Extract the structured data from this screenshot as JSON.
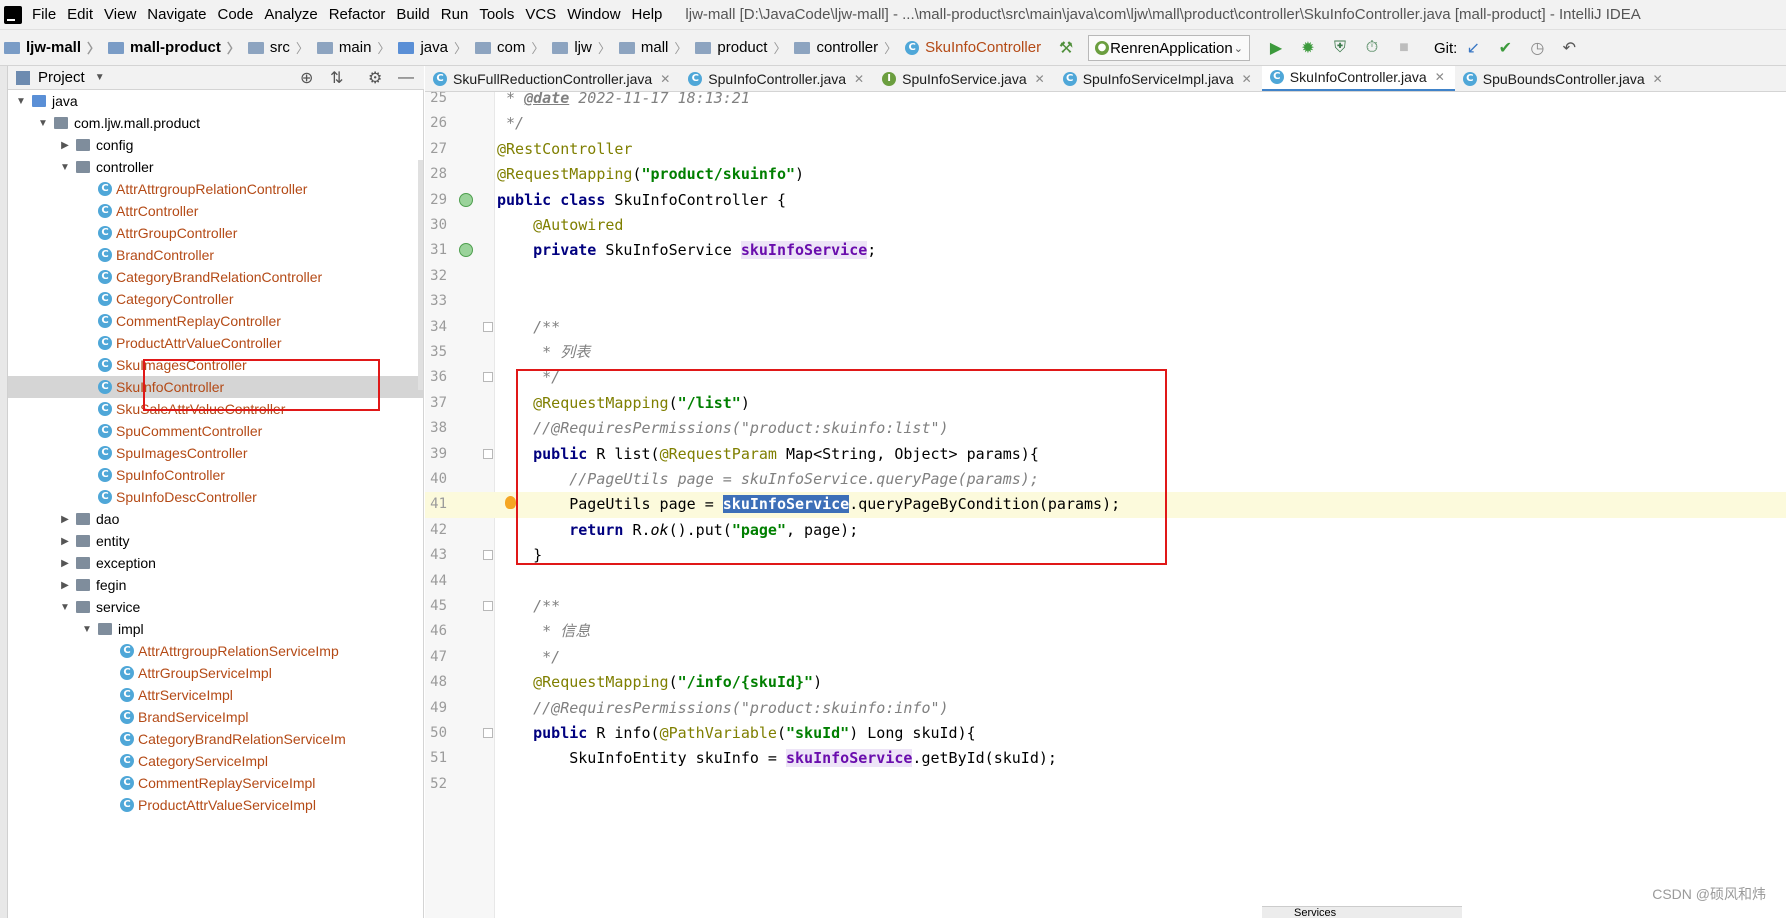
{
  "menubar": {
    "items": [
      "File",
      "Edit",
      "View",
      "Navigate",
      "Code",
      "Analyze",
      "Refactor",
      "Build",
      "Run",
      "Tools",
      "VCS",
      "Window",
      "Help"
    ],
    "title": "ljw-mall [D:\\JavaCode\\ljw-mall] - ...\\mall-product\\src\\main\\java\\com\\ljw\\mall\\product\\controller\\SkuInfoController.java [mall-product] - IntelliJ IDEA"
  },
  "breadcrumb": [
    "ljw-mall",
    "mall-product",
    "src",
    "main",
    "java",
    "com",
    "ljw",
    "mall",
    "product",
    "controller",
    "SkuInfoController"
  ],
  "run_config": "RenrenApplication",
  "git_label": "Git:",
  "project_panel": {
    "label": "Project"
  },
  "tree": [
    {
      "label": "java",
      "indent": 1,
      "arrow": "down",
      "type": "src"
    },
    {
      "label": "com.ljw.mall.product",
      "indent": 2,
      "arrow": "down",
      "type": "pkg"
    },
    {
      "label": "config",
      "indent": 3,
      "arrow": "right",
      "type": "pkg"
    },
    {
      "label": "controller",
      "indent": 3,
      "arrow": "down",
      "type": "pkg"
    },
    {
      "label": "AttrAttrgroupRelationController",
      "indent": 4,
      "type": "class"
    },
    {
      "label": "AttrController",
      "indent": 4,
      "type": "class"
    },
    {
      "label": "AttrGroupController",
      "indent": 4,
      "type": "class"
    },
    {
      "label": "BrandController",
      "indent": 4,
      "type": "class"
    },
    {
      "label": "CategoryBrandRelationController",
      "indent": 4,
      "type": "class"
    },
    {
      "label": "CategoryController",
      "indent": 4,
      "type": "class"
    },
    {
      "label": "CommentReplayController",
      "indent": 4,
      "type": "class"
    },
    {
      "label": "ProductAttrValueController",
      "indent": 4,
      "type": "class"
    },
    {
      "label": "SkuImagesController",
      "indent": 4,
      "type": "class"
    },
    {
      "label": "SkuInfoController",
      "indent": 4,
      "type": "class",
      "selected": true
    },
    {
      "label": "SkuSaleAttrValueController",
      "indent": 4,
      "type": "class"
    },
    {
      "label": "SpuCommentController",
      "indent": 4,
      "type": "class"
    },
    {
      "label": "SpuImagesController",
      "indent": 4,
      "type": "class"
    },
    {
      "label": "SpuInfoController",
      "indent": 4,
      "type": "class"
    },
    {
      "label": "SpuInfoDescController",
      "indent": 4,
      "type": "class"
    },
    {
      "label": "dao",
      "indent": 3,
      "arrow": "right",
      "type": "pkg"
    },
    {
      "label": "entity",
      "indent": 3,
      "arrow": "right",
      "type": "pkg"
    },
    {
      "label": "exception",
      "indent": 3,
      "arrow": "right",
      "type": "pkg"
    },
    {
      "label": "fegin",
      "indent": 3,
      "arrow": "right",
      "type": "pkg"
    },
    {
      "label": "service",
      "indent": 3,
      "arrow": "down",
      "type": "pkg"
    },
    {
      "label": "impl",
      "indent": 4,
      "arrow": "down",
      "type": "pkg"
    },
    {
      "label": "AttrAttrgroupRelationServiceImp",
      "indent": 5,
      "type": "class"
    },
    {
      "label": "AttrGroupServiceImpl",
      "indent": 5,
      "type": "class"
    },
    {
      "label": "AttrServiceImpl",
      "indent": 5,
      "type": "class"
    },
    {
      "label": "BrandServiceImpl",
      "indent": 5,
      "type": "class"
    },
    {
      "label": "CategoryBrandRelationServiceIm",
      "indent": 5,
      "type": "class"
    },
    {
      "label": "CategoryServiceImpl",
      "indent": 5,
      "type": "class"
    },
    {
      "label": "CommentReplayServiceImpl",
      "indent": 5,
      "type": "class"
    },
    {
      "label": "ProductAttrValueServiceImpl",
      "indent": 5,
      "type": "class"
    }
  ],
  "tabs": [
    {
      "label": "SkuFullReductionController.java",
      "icon": "c"
    },
    {
      "label": "SpuInfoController.java",
      "icon": "c"
    },
    {
      "label": "SpuInfoService.java",
      "icon": "i"
    },
    {
      "label": "SpuInfoServiceImpl.java",
      "icon": "c"
    },
    {
      "label": "SkuInfoController.java",
      "icon": "c",
      "active": true
    },
    {
      "label": "SpuBoundsController.java",
      "icon": "c"
    }
  ],
  "code_lines": [
    {
      "n": "25",
      "html": "<span class='cm'> * </span><span class='doctag'>@date</span><span class='cm'> 2022-11-17 18:13:21</span>"
    },
    {
      "n": "26",
      "html": "<span class='cm'> */</span>"
    },
    {
      "n": "27",
      "html": "<span class='ann'>@RestController</span>"
    },
    {
      "n": "28",
      "html": "<span class='ann'>@RequestMapping</span>(<span class='str'>\"product/skuinfo\"</span>)"
    },
    {
      "n": "29",
      "html": "<span class='kw'>public class</span> SkuInfoController {",
      "gmark": true
    },
    {
      "n": "30",
      "html": "    <span class='ann'>@Autowired</span>"
    },
    {
      "n": "31",
      "html": "    <span class='kw'>private</span> SkuInfoService <span class='fld'>skuInfoService</span>;",
      "gmark": true
    },
    {
      "n": "32",
      "html": ""
    },
    {
      "n": "33",
      "html": ""
    },
    {
      "n": "34",
      "html": "    <span class='cm'>/**</span>",
      "fold": true
    },
    {
      "n": "35",
      "html": "<span class='cm'>     * 列表</span>"
    },
    {
      "n": "36",
      "html": "<span class='cm'>     */</span>",
      "fold": true
    },
    {
      "n": "37",
      "html": "    <span class='ann'>@RequestMapping</span>(<span class='str'>\"/list\"</span>)"
    },
    {
      "n": "38",
      "html": "    <span class='cm'>//@RequiresPermissions(\"product:skuinfo:list\")</span>"
    },
    {
      "n": "39",
      "html": "    <span class='kw'>public</span> R list(<span class='ann'>@RequestParam</span> Map&lt;String, Object&gt; params){",
      "fold": true
    },
    {
      "n": "40",
      "html": "        <span class='cm'>//PageUtils page = skuInfoService.queryPage(params);</span>"
    },
    {
      "n": "41",
      "html": "        PageUtils page = <span class='fld hl'>skuInfoService</span>.queryPageByCondition(params);",
      "current": true,
      "bulb": true
    },
    {
      "n": "42",
      "html": "        <span class='kw'>return</span> R.<span class='ital'>ok</span>().put(<span class='str'>\"page\"</span>, page);"
    },
    {
      "n": "43",
      "html": "    }",
      "fold": true
    },
    {
      "n": "44",
      "html": ""
    },
    {
      "n": "45",
      "html": "    <span class='cm'>/**</span>",
      "fold": true
    },
    {
      "n": "46",
      "html": "<span class='cm'>     * 信息</span>"
    },
    {
      "n": "47",
      "html": "<span class='cm'>     */</span>"
    },
    {
      "n": "48",
      "html": "    <span class='ann'>@RequestMapping</span>(<span class='str'>\"/info/{skuId}\"</span>)"
    },
    {
      "n": "49",
      "html": "    <span class='cm'>//@RequiresPermissions(\"product:skuinfo:info\")</span>"
    },
    {
      "n": "50",
      "html": "    <span class='kw'>public</span> R info(<span class='ann'>@PathVariable</span>(<span class='str'>\"skuId\"</span>) Long skuId){",
      "fold": true
    },
    {
      "n": "51",
      "html": "        SkuInfoEntity skuInfo = <span class='fld'>skuInfoService</span>.getById(skuId);"
    },
    {
      "n": "52",
      "html": ""
    }
  ],
  "watermark": "CSDN @硕风和炜",
  "services_tab": "Services"
}
